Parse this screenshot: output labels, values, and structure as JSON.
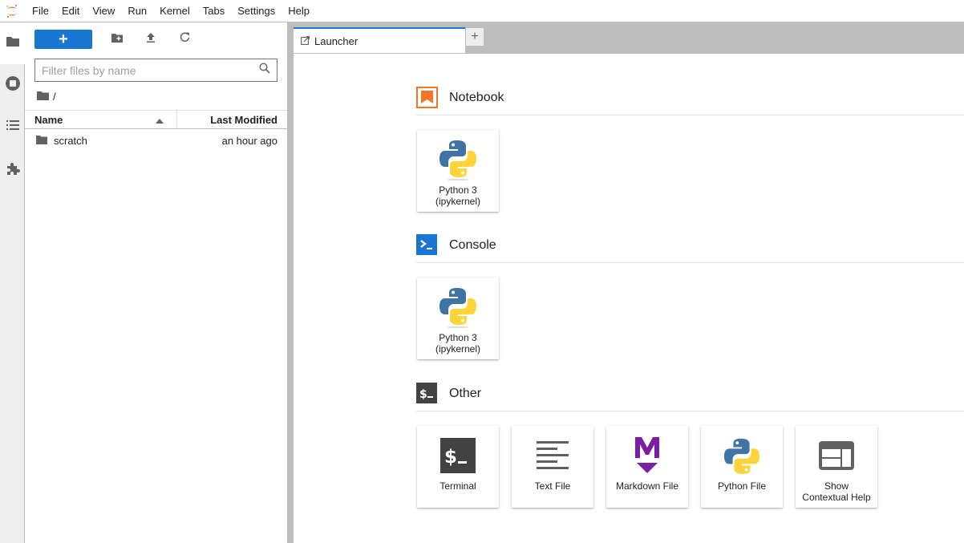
{
  "menubar": {
    "logo": "jupyter-logo-icon",
    "items": [
      "File",
      "Edit",
      "View",
      "Run",
      "Kernel",
      "Tabs",
      "Settings",
      "Help"
    ]
  },
  "activitybar": {
    "items": [
      {
        "name": "file-browser",
        "icon": "folder-icon",
        "active": true
      },
      {
        "name": "running-kernels",
        "icon": "stop-circle-icon",
        "active": false
      },
      {
        "name": "table-of-contents",
        "icon": "list-icon",
        "active": false
      },
      {
        "name": "extension-manager",
        "icon": "puzzle-icon",
        "active": false
      }
    ]
  },
  "filebrowser": {
    "new_launcher_label": "+",
    "toolbar_icons": [
      "new-folder-icon",
      "upload-icon",
      "refresh-icon"
    ],
    "filter_placeholder": "Filter files by name",
    "filter_value": "",
    "breadcrumb": "/",
    "columns": {
      "name": "Name",
      "modified": "Last Modified"
    },
    "files": [
      {
        "name": "scratch",
        "type": "folder",
        "modified": "an hour ago"
      }
    ]
  },
  "tabs": {
    "items": [
      {
        "label": "Launcher",
        "icon": "launcher-icon",
        "active": true
      }
    ],
    "add_label": "+"
  },
  "launcher": {
    "sections": [
      {
        "title": "Notebook",
        "icon": "notebook-icon",
        "icon_color": "#f37726",
        "cards": [
          {
            "label_line1": "Python 3",
            "label_line2": "(ipykernel)",
            "icon": "python-logo-icon"
          }
        ]
      },
      {
        "title": "Console",
        "icon": "console-icon",
        "icon_color": "#1976d2",
        "cards": [
          {
            "label_line1": "Python 3",
            "label_line2": "(ipykernel)",
            "icon": "python-logo-icon"
          }
        ]
      },
      {
        "title": "Other",
        "icon": "terminal-icon",
        "icon_color": "#424242",
        "cards": [
          {
            "label_line1": "Terminal",
            "label_line2": "",
            "icon": "terminal-icon"
          },
          {
            "label_line1": "Text File",
            "label_line2": "",
            "icon": "text-file-icon"
          },
          {
            "label_line1": "Markdown File",
            "label_line2": "",
            "icon": "markdown-icon"
          },
          {
            "label_line1": "Python File",
            "label_line2": "",
            "icon": "python-logo-icon"
          },
          {
            "label_line1": "Show",
            "label_line2": "Contextual Help",
            "icon": "contextual-help-icon"
          }
        ]
      }
    ]
  },
  "colors": {
    "accent": "#1976d2",
    "jupyter_orange": "#f37726",
    "markdown_purple": "#7b1fa2",
    "python_blue": "#3f74a5",
    "python_yellow": "#ffd43b"
  }
}
